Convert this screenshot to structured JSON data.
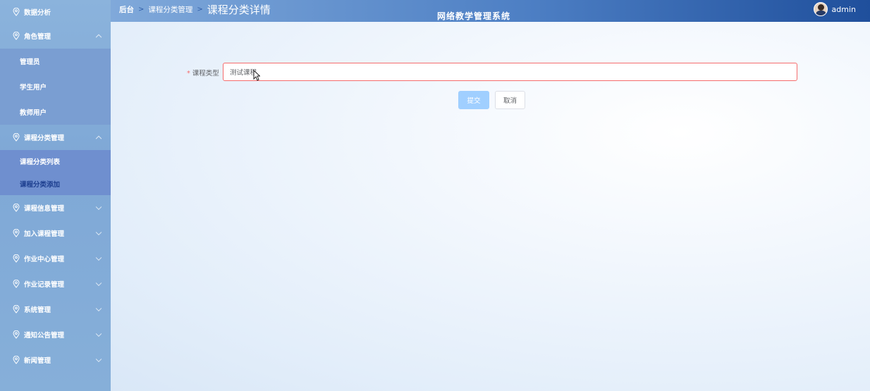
{
  "app": {
    "system_title": "网络教学管理系统",
    "username": "admin"
  },
  "breadcrumb": {
    "home": "后台",
    "section": "课程分类管理",
    "current": "课程分类详情"
  },
  "sidebar": {
    "items": [
      {
        "label": "数据分析"
      },
      {
        "label": "角色管理",
        "expanded": true,
        "children": [
          "管理员",
          "学生用户",
          "教师用户"
        ]
      },
      {
        "label": "课程分类管理",
        "expanded": true,
        "children": [
          "课程分类列表",
          "课程分类添加"
        ]
      },
      {
        "label": "课程信息管理"
      },
      {
        "label": "加入课程管理"
      },
      {
        "label": "作业中心管理"
      },
      {
        "label": "作业记录管理"
      },
      {
        "label": "系统管理"
      },
      {
        "label": "通知公告管理"
      },
      {
        "label": "新闻管理"
      }
    ],
    "active_child": "课程分类添加"
  },
  "form": {
    "course_type_label": "课程类型",
    "required_mark": "*",
    "course_type_value": "测试课程",
    "submit_label": "提交",
    "cancel_label": "取消"
  },
  "colors": {
    "sidebar_bg": "#86afd9",
    "header_end": "#1f4f9c",
    "error_border": "#f56c6c",
    "submit_bg": "#a0cfff"
  }
}
